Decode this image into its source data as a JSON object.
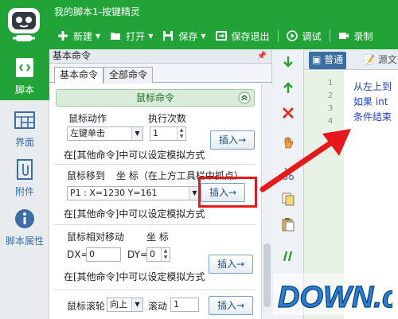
{
  "window": {
    "title": "我的脚本1-按键精灵"
  },
  "toolbar": {
    "new_label": "新建",
    "open_label": "打开",
    "save_label": "保存",
    "save_exit_label": "保存退出",
    "debug_label": "调试",
    "record_label": "录制"
  },
  "leftnav": {
    "items": [
      {
        "label": "脚本",
        "icon": "script-icon"
      },
      {
        "label": "界面",
        "icon": "layout-icon"
      },
      {
        "label": "附件",
        "icon": "attachment-icon"
      },
      {
        "label": "脚本属性",
        "icon": "info-icon"
      }
    ]
  },
  "panel": {
    "title": "基本命令",
    "tabs": [
      "基本命令",
      "全部命令"
    ],
    "section_title": "鼠标命令",
    "mouse_action": {
      "action_label": "鼠标动作",
      "count_label": "执行次数",
      "action_value": "左键单击",
      "count_value": "1",
      "hint": "在[其他命令]中可以设定模拟方式",
      "insert_label": "插入→"
    },
    "mouse_move": {
      "label": "鼠标移到",
      "coord_label": "坐 标（在上方工具栏中抓点）",
      "coord_value": "P1 : X=1230 Y=161",
      "hint": "在[其他命令]中可以设定模拟方式",
      "insert_label": "插入→"
    },
    "mouse_relative": {
      "label": "鼠标相对移动",
      "coord_label": "坐 标",
      "dx_label": "DX=",
      "dx_value": "0",
      "dy_label": "DY=",
      "dy_value": "0",
      "hint": "在[其他命令]中可以设定模拟方式",
      "insert_label": "插入→"
    },
    "mouse_wheel": {
      "label": "鼠标滚轮",
      "direction_value": "向上",
      "scroll_label": "滚动",
      "scroll_value": "1",
      "insert_label": "插入→"
    }
  },
  "editor": {
    "tabs": [
      "普通",
      "源文"
    ],
    "line_numbers": [
      "1",
      "2",
      "3",
      "4"
    ],
    "lines": [
      "从左上到",
      "如果 int",
      "条件结束"
    ]
  },
  "watermark": {
    "text": "DOWN.cc"
  },
  "colors": {
    "accent": "#21a337",
    "highlight": "#e5181c",
    "code": "#1f3fbf"
  }
}
